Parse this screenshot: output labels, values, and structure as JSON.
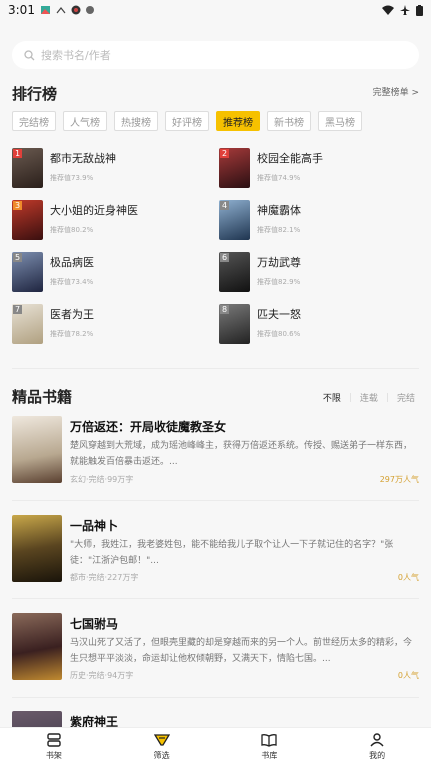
{
  "status": {
    "time": "3:01"
  },
  "search": {
    "placeholder": "搜索书名/作者"
  },
  "ranking": {
    "title": "排行榜",
    "more": "完整榜单 >",
    "tabs": [
      "完结榜",
      "人气榜",
      "热搜榜",
      "好评榜",
      "推荐榜",
      "新书榜",
      "黑马榜"
    ],
    "active_tab": 4,
    "items": [
      {
        "num": "1",
        "title": "都市无敌战神",
        "stat": "推荐值73.9%",
        "color": "#3b2f2a"
      },
      {
        "num": "2",
        "title": "校园全能高手",
        "stat": "推荐值74.9%",
        "color": "#5a1e22"
      },
      {
        "num": "3",
        "title": "大小姐的近身神医",
        "stat": "推荐值80.2%",
        "color": "#6b1d1d"
      },
      {
        "num": "4",
        "title": "神魔霸体",
        "stat": "推荐值82.1%",
        "color": "#2a4b6b"
      },
      {
        "num": "5",
        "title": "极品病医",
        "stat": "推荐值73.4%",
        "color": "#2f3d5c"
      },
      {
        "num": "6",
        "title": "万劫武尊",
        "stat": "推荐值82.9%",
        "color": "#2a2a2a"
      },
      {
        "num": "7",
        "title": "医者为王",
        "stat": "推荐值78.2%",
        "color": "#c9c0b0"
      },
      {
        "num": "8",
        "title": "匹夫一怒",
        "stat": "推荐值80.6%",
        "color": "#4a4a4a"
      }
    ]
  },
  "featured": {
    "title": "精品书籍",
    "filters": [
      "不限",
      "连载",
      "完结"
    ],
    "books": [
      {
        "title": "万倍返还：开局收徒魔教圣女",
        "desc": "楚风穿越到大荒域，成为瑶池峰峰主，获得万倍返还系统。传授、赐送弟子一样东西，就能触发百倍暴击返还。...",
        "meta": "玄幻·完结·99万字",
        "pop": "297万人气",
        "color": "#d9cfc4"
      },
      {
        "title": "一品神卜",
        "desc": "\"大师，我姓江，我老婆姓包，能不能给我儿子取个让人一下子就记住的名字？\"张徒：\"江浙沪包邮！\"...",
        "meta": "都市·完结·227万字",
        "pop": "0人气",
        "color": "#3d3320"
      },
      {
        "title": "七国驸马",
        "desc": "马汉山死了又活了，但眼壳里藏的却是穿越而来的另一个人。前世经历太多的精彩，今生只想平平淡淡，命运却让他权倾朝野，又满天下，情陷七国。...",
        "meta": "历史·完结·94万字",
        "pop": "0人气",
        "color": "#4a2c2c"
      },
      {
        "title": "紫府神王",
        "desc": "",
        "meta": "",
        "pop": "",
        "color": "#2c2c3a"
      }
    ]
  },
  "nav": [
    {
      "label": "书架",
      "icon": "bookshelf-icon"
    },
    {
      "label": "筛选",
      "icon": "filter-icon"
    },
    {
      "label": "书库",
      "icon": "library-icon"
    },
    {
      "label": "我的",
      "icon": "profile-icon"
    }
  ]
}
